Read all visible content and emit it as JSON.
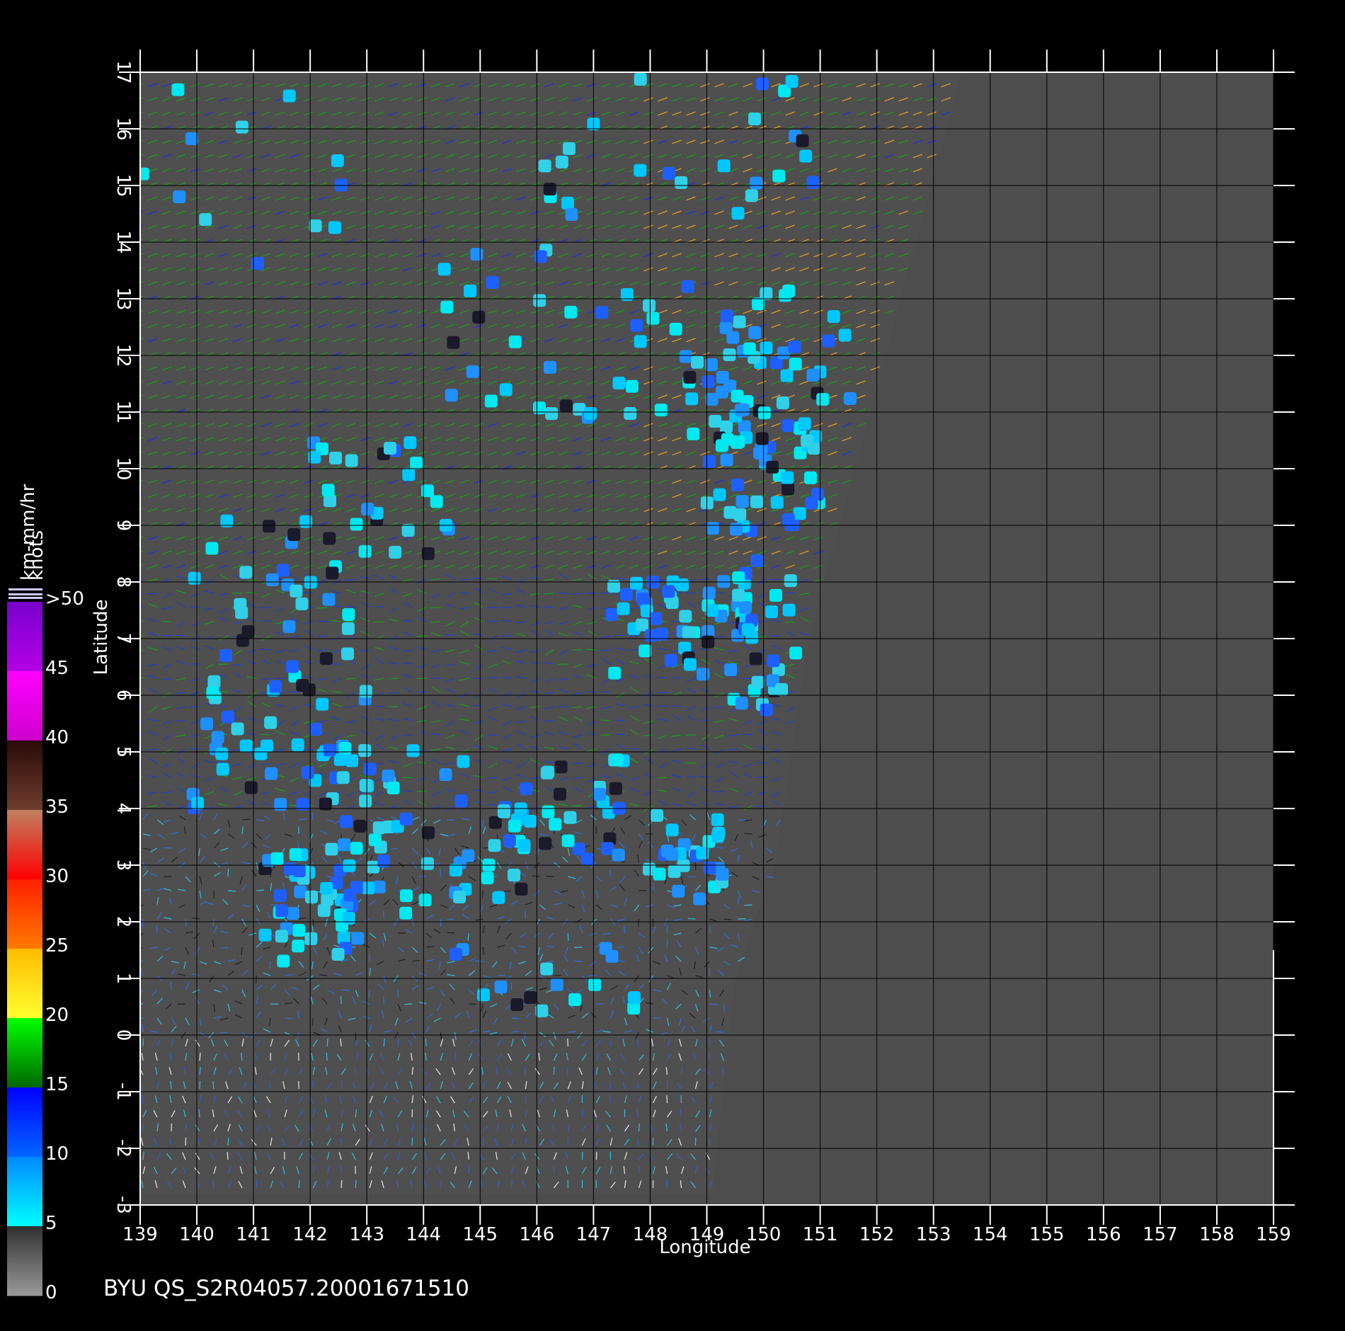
{
  "title": "BYU  QS_S2R04057.20001671510",
  "axes": {
    "xlabel": "Longitude",
    "ylabel": "Latitude",
    "lon_ticks": [
      139,
      140,
      141,
      142,
      143,
      144,
      145,
      146,
      147,
      148,
      149,
      150,
      151,
      152,
      153,
      154,
      155,
      156,
      157,
      158,
      159
    ],
    "lat_ticks": [
      17,
      16,
      15,
      14,
      13,
      12,
      11,
      10,
      9,
      8,
      7,
      6,
      5,
      4,
      3,
      2,
      1,
      0,
      -1,
      -2,
      -3
    ],
    "lon_range": [
      139,
      159
    ],
    "lat_range": [
      -3,
      17
    ],
    "grid": true
  },
  "colorbar": {
    "units_top": "km-mm/hr",
    "units_bottom": "knots",
    "labels": [
      ">50",
      "45",
      "40",
      "35",
      "30",
      "25",
      "20",
      "15",
      "10",
      "5",
      "0"
    ],
    "bands": [
      {
        "from": "#7700cc",
        "to": "#b400e6"
      },
      {
        "from": "#ff00ff",
        "to": "#cc00cc"
      },
      {
        "from": "#2a0a08",
        "to": "#6e3d2e"
      },
      {
        "from": "#c08060",
        "to": "#ff0000"
      },
      {
        "from": "#ff2000",
        "to": "#ff7a00"
      },
      {
        "from": "#ffbb00",
        "to": "#ffff30"
      },
      {
        "from": "#00ff00",
        "to": "#006600"
      },
      {
        "from": "#0000ff",
        "to": "#0066ff"
      },
      {
        "from": "#0088ff",
        "to": "#00ffff"
      },
      {
        "from": "#303030",
        "to": "#9a9a9a"
      }
    ]
  },
  "colors": {
    "background": "#000000",
    "ocean_no_data": "#4d4d4d",
    "grid_line": "#000000"
  }
}
